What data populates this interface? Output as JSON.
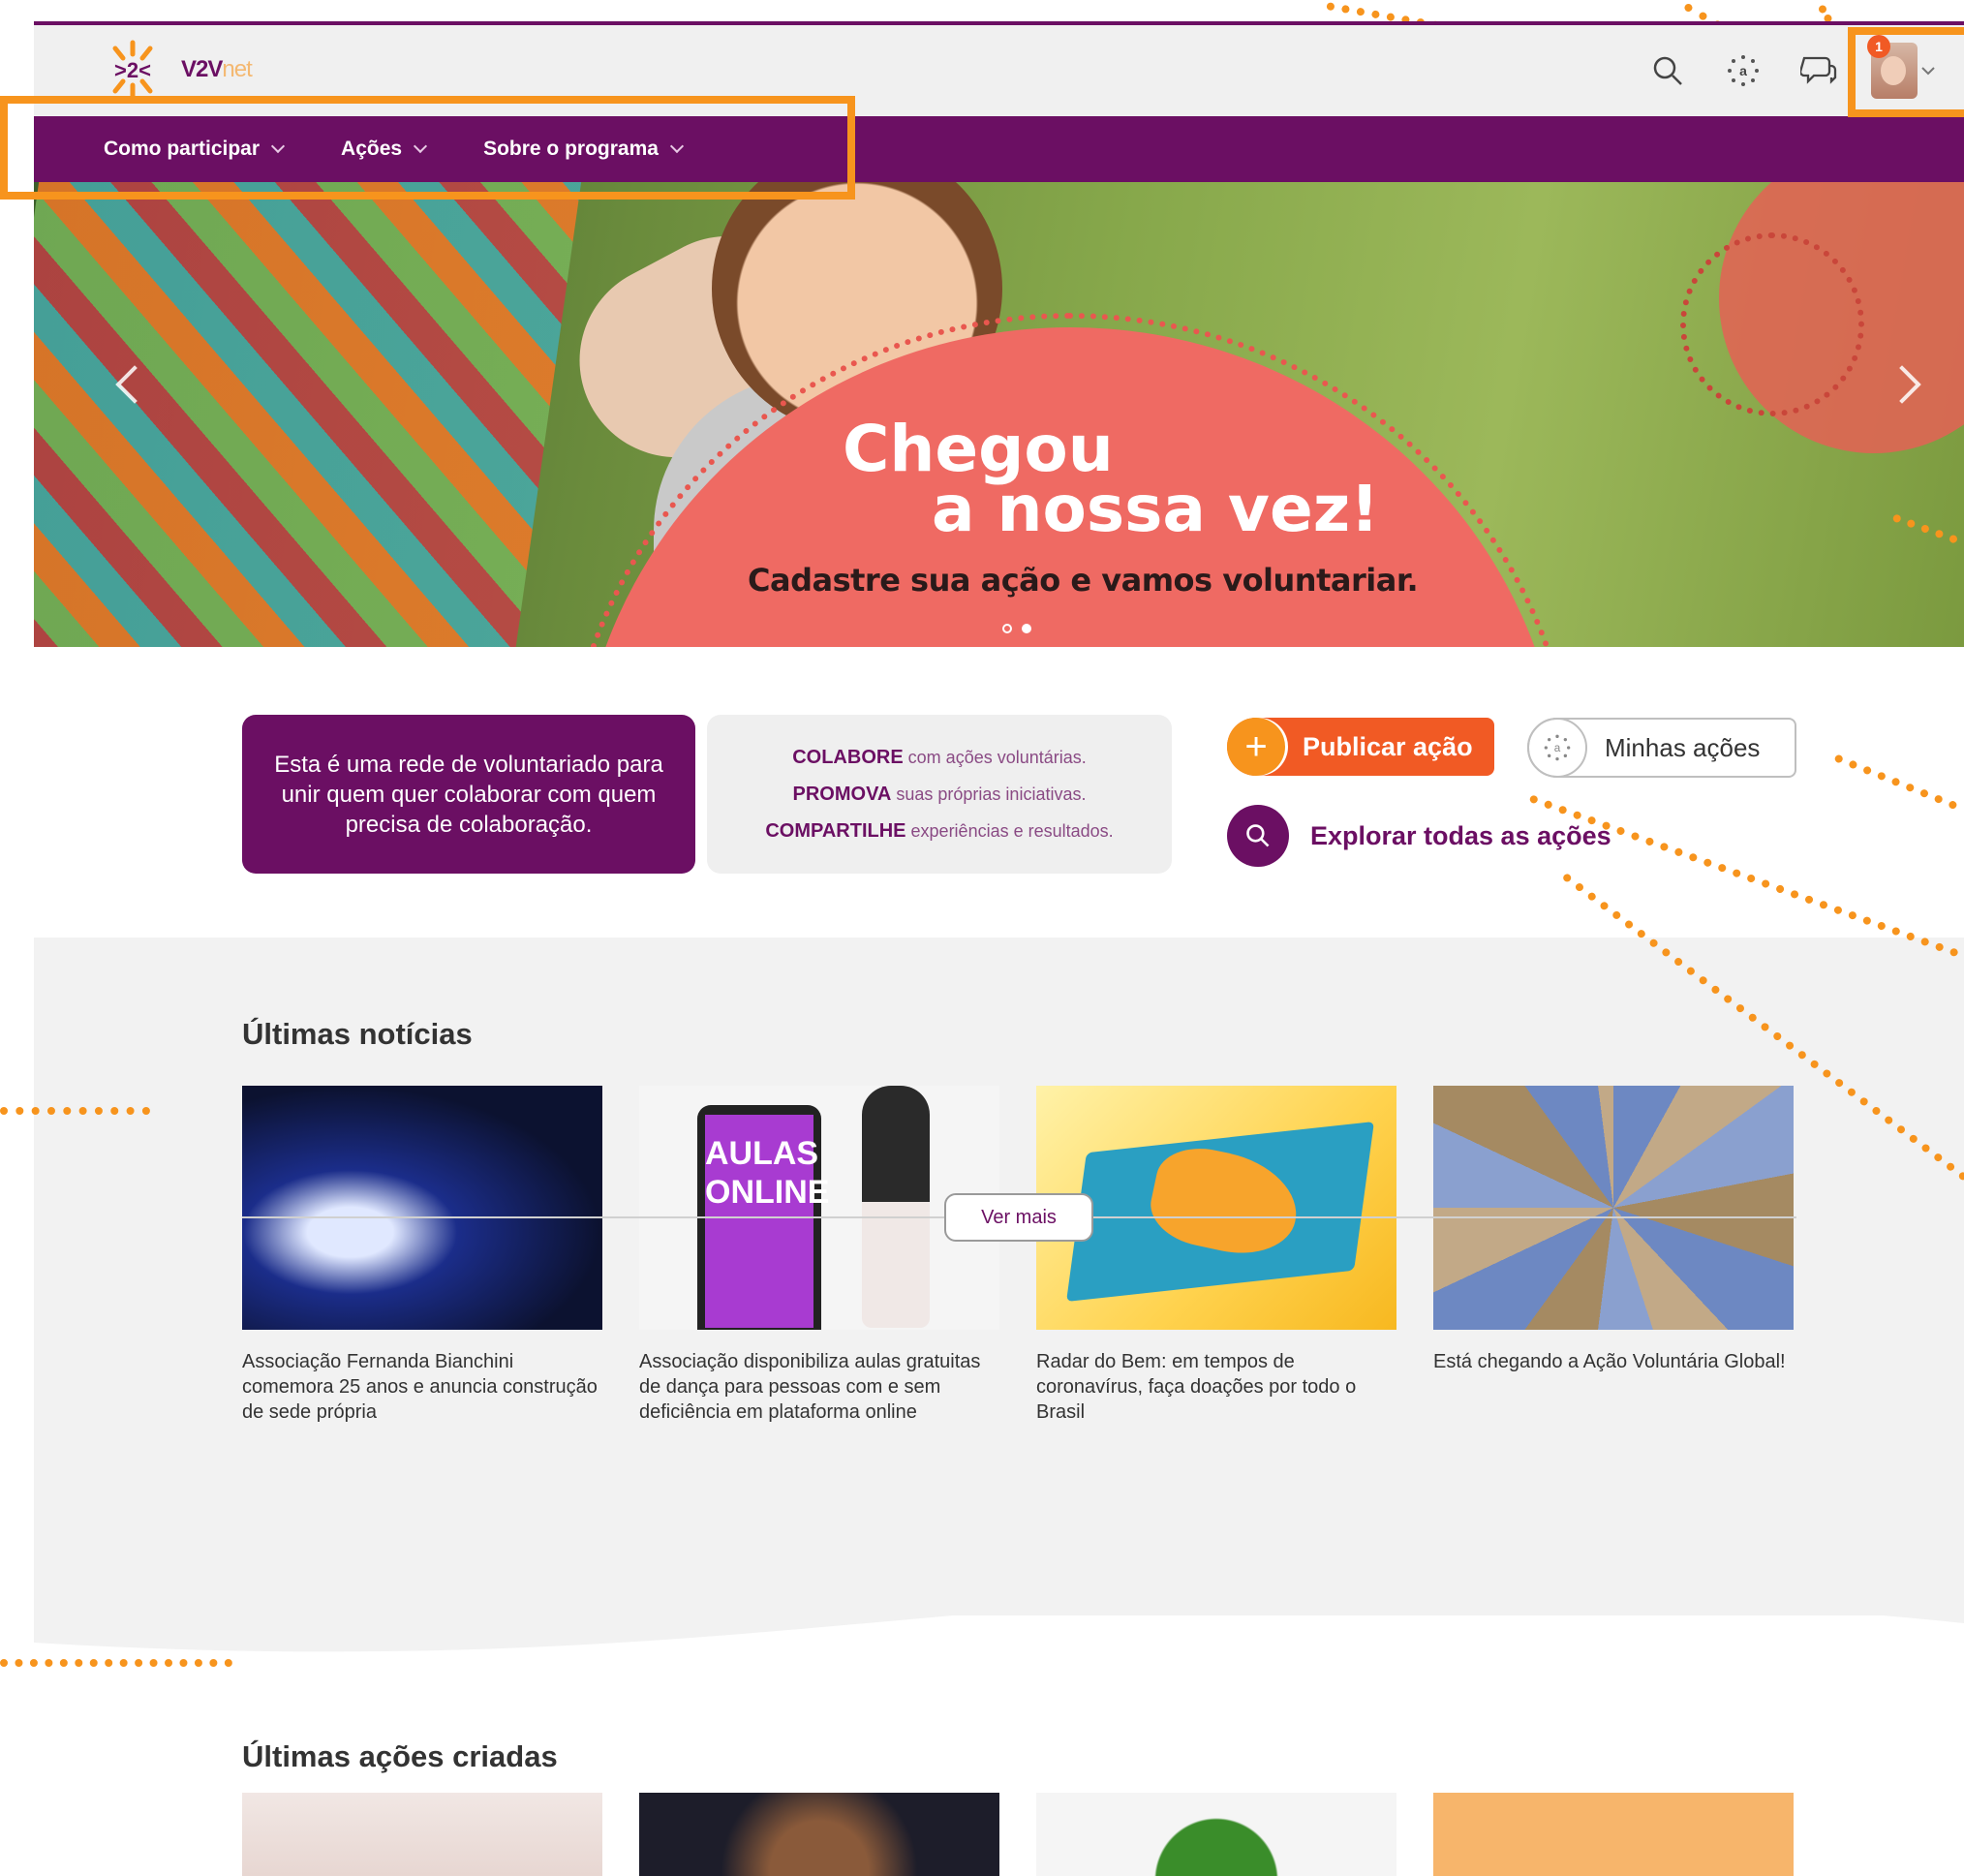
{
  "header": {
    "logo_text": "V2V",
    "logo_suffix": "net",
    "notification_count": "1",
    "icons": [
      "search-icon",
      "sun-icon",
      "chat-icon",
      "user-avatar"
    ]
  },
  "nav": {
    "items": [
      "Como participar",
      "Ações",
      "Sobre o programa"
    ]
  },
  "hero": {
    "title_line1": "Chegou",
    "title_line2": "a nossa vez!",
    "subtitle": "Cadastre sua ação e vamos voluntariar."
  },
  "intro": {
    "purple_text": "Esta é uma rede de voluntariado para unir quem quer colaborar com quem precisa de colaboração.",
    "lines": [
      {
        "key": "COLABORE",
        "rest": " com ações voluntárias."
      },
      {
        "key": "PROMOVA",
        "rest": " suas próprias iniciativas."
      },
      {
        "key": "COMPARTILHE",
        "rest": " experiências e resultados."
      }
    ]
  },
  "actions_bar": {
    "publish_label": "Publicar ação",
    "mine_label": "Minhas ações",
    "explore_label": "Explorar todas as ações"
  },
  "news": {
    "title": "Últimas notícias",
    "items": [
      {
        "caption": "Associação Fernanda Bianchini comemora 25 anos e anuncia construção de sede própria"
      },
      {
        "caption": "Associação disponibiliza aulas gratuitas de dança para pessoas com e sem deficiência em plataforma online",
        "image_text": "AULAS ONLINE"
      },
      {
        "caption": "Radar do Bem: em tempos de coronavírus, faça doações por todo o Brasil"
      },
      {
        "caption": "Está chegando a Ação Voluntária Global!"
      }
    ],
    "more_label": "Ver mais"
  },
  "latest_actions": {
    "title": "Últimas ações criadas"
  },
  "colors": {
    "brand_purple": "#6b0f63",
    "brand_orange": "#f15a24",
    "annotation_orange": "#f7941d",
    "hero_coral": "#ef6a63"
  }
}
